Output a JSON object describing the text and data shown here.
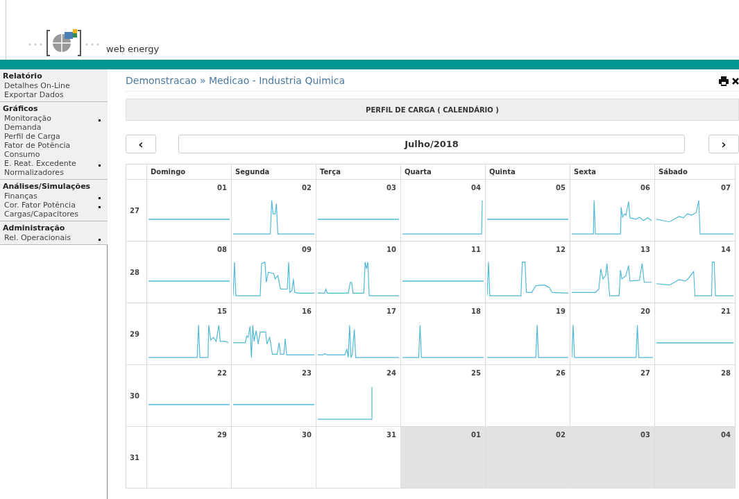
{
  "header": {
    "logo_text": "web energy"
  },
  "sidebar": {
    "sections": [
      {
        "title": "Relatório",
        "items": [
          {
            "label": "Detalhes On-Line",
            "marker": false
          },
          {
            "label": "Exportar Dados",
            "marker": false
          }
        ]
      },
      {
        "title": "Gráficos",
        "items": [
          {
            "label": "Monitoração",
            "marker": true
          },
          {
            "label": "Demanda",
            "marker": false
          },
          {
            "label": "Perfil de Carga",
            "marker": false
          },
          {
            "label": "Fator de Potência",
            "marker": false
          },
          {
            "label": "Consumo",
            "marker": false
          },
          {
            "label": "E. Reat. Excedente",
            "marker": true
          },
          {
            "label": "Normalizadores",
            "marker": false
          }
        ]
      },
      {
        "title": "Análises/Simulações",
        "items": [
          {
            "label": "Finanças",
            "marker": true
          },
          {
            "label": "Cor. Fator Potência",
            "marker": true
          },
          {
            "label": "Cargas/Capacitores",
            "marker": false
          }
        ]
      },
      {
        "title": "Administração",
        "items": [
          {
            "label": "Rel. Operacionais",
            "marker": true
          }
        ]
      }
    ]
  },
  "breadcrumb": "Demonstracao » Medicao - Industria Quimica",
  "panel_title": "PERFIL DE CARGA ( CALENDÁRIO )",
  "nav": {
    "prev": "‹",
    "month": "Julho/2018",
    "next": "›"
  },
  "calendar": {
    "weekdays": [
      "Domingo",
      "Segunda",
      "Terça",
      "Quarta",
      "Quinta",
      "Sexta",
      "Sábado"
    ],
    "weeks": [
      {
        "number": "27",
        "days": [
          {
            "date": "01",
            "kind": "flat",
            "outside_month": false
          },
          {
            "date": "02",
            "kind": "trace",
            "outside_month": false
          },
          {
            "date": "03",
            "kind": "flat",
            "outside_month": false
          },
          {
            "date": "04",
            "kind": "trace",
            "outside_month": false
          },
          {
            "date": "05",
            "kind": "flat",
            "outside_month": false
          },
          {
            "date": "06",
            "kind": "trace",
            "outside_month": false
          },
          {
            "date": "07",
            "kind": "trace",
            "outside_month": false
          }
        ]
      },
      {
        "number": "28",
        "days": [
          {
            "date": "08",
            "kind": "flat",
            "outside_month": false
          },
          {
            "date": "09",
            "kind": "trace",
            "outside_month": false
          },
          {
            "date": "10",
            "kind": "trace",
            "outside_month": false
          },
          {
            "date": "11",
            "kind": "flat",
            "outside_month": false
          },
          {
            "date": "12",
            "kind": "trace",
            "outside_month": false
          },
          {
            "date": "13",
            "kind": "trace",
            "outside_month": false
          },
          {
            "date": "14",
            "kind": "trace",
            "outside_month": false
          }
        ]
      },
      {
        "number": "29",
        "days": [
          {
            "date": "15",
            "kind": "trace",
            "outside_month": false
          },
          {
            "date": "16",
            "kind": "trace",
            "outside_month": false
          },
          {
            "date": "17",
            "kind": "trace",
            "outside_month": false
          },
          {
            "date": "18",
            "kind": "trace",
            "outside_month": false
          },
          {
            "date": "19",
            "kind": "trace",
            "outside_month": false
          },
          {
            "date": "20",
            "kind": "trace",
            "outside_month": false
          },
          {
            "date": "21",
            "kind": "flat",
            "outside_month": false
          }
        ]
      },
      {
        "number": "30",
        "days": [
          {
            "date": "22",
            "kind": "flat",
            "outside_month": false
          },
          {
            "date": "23",
            "kind": "flat",
            "outside_month": false
          },
          {
            "date": "24",
            "kind": "trace",
            "outside_month": false
          },
          {
            "date": "25",
            "kind": "none",
            "outside_month": false
          },
          {
            "date": "26",
            "kind": "none",
            "outside_month": false
          },
          {
            "date": "27",
            "kind": "none",
            "outside_month": false
          },
          {
            "date": "28",
            "kind": "none",
            "outside_month": false
          }
        ]
      },
      {
        "number": "31",
        "days": [
          {
            "date": "29",
            "kind": "none",
            "outside_month": false
          },
          {
            "date": "30",
            "kind": "none",
            "outside_month": false
          },
          {
            "date": "31",
            "kind": "none",
            "outside_month": false
          },
          {
            "date": "01",
            "kind": "none",
            "outside_month": true
          },
          {
            "date": "02",
            "kind": "none",
            "outside_month": true
          },
          {
            "date": "03",
            "kind": "none",
            "outside_month": true
          },
          {
            "date": "04",
            "kind": "none",
            "outside_month": true
          }
        ]
      }
    ]
  }
}
